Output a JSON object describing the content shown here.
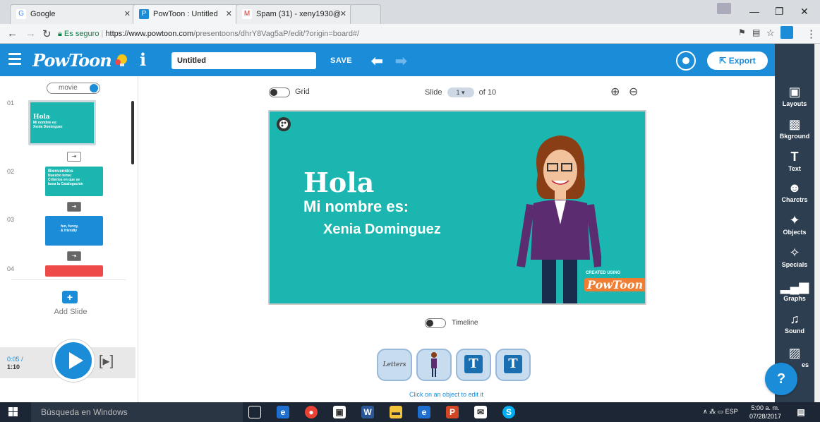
{
  "browser": {
    "tabs": [
      {
        "label": "Google",
        "icon": "google-icon"
      },
      {
        "label": "PowToon : Untitled",
        "icon": "powtoon-icon"
      },
      {
        "label": "Spam (31) - xeny1930@",
        "icon": "gmail-icon"
      }
    ],
    "secure_label": "Es seguro",
    "url_host": "https://www.powtoon.com",
    "url_path": "/presentoons/dhrY8Vag5aP/edit/?origin=board#/"
  },
  "header": {
    "logo": "PowToon",
    "info_label": "i",
    "title_value": "Untitled",
    "save_label": "SAVE",
    "export_label": "Export"
  },
  "left_panel": {
    "movie_label": "movie",
    "slides": [
      {
        "num": "01",
        "title": "Hola",
        "line1": "Mi nombre es:",
        "line2": "Xenia Dominguez",
        "color": "#1cb6b0"
      },
      {
        "num": "02",
        "title": "Bienvenidos",
        "line1": "Nuestro tema:",
        "line2": "Criterios en que se basa la Catalogación",
        "color": "#1cb6b0"
      },
      {
        "num": "03",
        "title": "",
        "line1": "fun, funny,",
        "line2": "& friendly",
        "color": "#1a8cd8"
      },
      {
        "num": "04",
        "title": "",
        "line1": "",
        "line2": "",
        "color": "#ef4a4a"
      }
    ],
    "add_slide_label": "Add Slide"
  },
  "player": {
    "current": "0:05 /",
    "total": "1:10"
  },
  "canvas_controls": {
    "grid_label": "Grid",
    "slide_label": "Slide",
    "slide_value": "1",
    "slide_of": "of 10"
  },
  "slide": {
    "title": "Hola",
    "line1": "Mi nombre es:",
    "line2": "Xenia Dominguez",
    "created_using": "CREATED USING",
    "brand": "PowToon",
    "bg_color": "#1cb6b0"
  },
  "timeline_label": "Timeline",
  "object_buttons": [
    {
      "label": "Letters"
    },
    {
      "label": ""
    },
    {
      "label": "T"
    },
    {
      "label": "T"
    }
  ],
  "click_hint": "Click on an object to edit it",
  "right_tools": [
    {
      "label": "Layouts",
      "icon": "layouts-icon"
    },
    {
      "label": "Bkground",
      "icon": "background-icon"
    },
    {
      "label": "Text",
      "icon": "text-icon"
    },
    {
      "label": "Charctrs",
      "icon": "characters-icon"
    },
    {
      "label": "Objects",
      "icon": "objects-icon"
    },
    {
      "label": "Specials",
      "icon": "specials-icon"
    },
    {
      "label": "Graphs",
      "icon": "graphs-icon"
    },
    {
      "label": "Sound",
      "icon": "sound-icon"
    },
    {
      "label": "es",
      "icon": "images-icon"
    }
  ],
  "help_label": "?",
  "taskbar": {
    "search_placeholder": "Búsqueda en Windows",
    "lang": "ESP",
    "time": "5:00 a. m.",
    "date": "07/28/2017"
  }
}
